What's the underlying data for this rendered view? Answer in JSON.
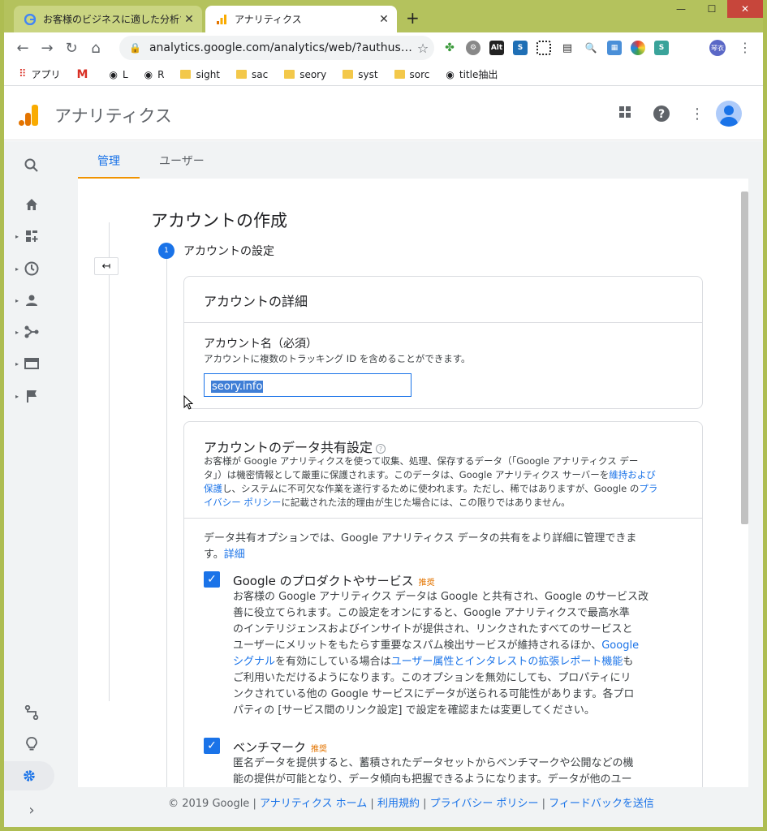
{
  "browser": {
    "tabs": [
      {
        "title": "お客様のビジネスに適した分析ツール",
        "active": false
      },
      {
        "title": "アナリティクス",
        "active": true
      }
    ],
    "new_tab_label": "+",
    "url": "analytics.google.com/analytics/web/?authus…",
    "bookmarks": [
      {
        "label": "アプリ",
        "icon": "apps-grid-icon"
      },
      {
        "label": "",
        "icon": "gmail-icon"
      },
      {
        "label": "L",
        "icon": "globe-icon"
      },
      {
        "label": "R",
        "icon": "globe-icon"
      },
      {
        "label": "sight",
        "icon": "folder-icon"
      },
      {
        "label": "sac",
        "icon": "folder-icon"
      },
      {
        "label": "seory",
        "icon": "folder-icon"
      },
      {
        "label": "syst",
        "icon": "folder-icon"
      },
      {
        "label": "sorc",
        "icon": "folder-icon"
      },
      {
        "label": "title抽出",
        "icon": "globe-icon"
      }
    ],
    "profile_initials": "琴衣",
    "extensions": [
      "Alt",
      "S",
      "S"
    ]
  },
  "app": {
    "title": "アナリティクス"
  },
  "subtabs": [
    {
      "label": "管理",
      "active": true
    },
    {
      "label": "ユーザー",
      "active": false
    }
  ],
  "content": {
    "page_title": "アカウントの作成",
    "step_number": "1",
    "step_label": "アカウントの設定",
    "details_card": {
      "heading": "アカウントの詳細",
      "name_label": "アカウント名（必須）",
      "name_help": "アカウントに複数のトラッキング ID を含めることができます。",
      "name_value": "seory.info"
    },
    "sharing_card": {
      "heading": "アカウントのデータ共有設定",
      "intro_a": "お客様が Google アナリティクスを使って収集、処理、保存するデータ（「Google アナリティクス デー",
      "intro_b": "タ」）は機密情報として厳重に保護されます。このデータは、Google アナリティクス サーバーを",
      "intro_link1": "維持およ",
      "intro_link1b": "び",
      "intro_c": "保護",
      "intro_d": "し、システムに不可欠な作業を遂行するために使われます。ただし、稀ではありますが、Google の",
      "intro_link2": "プラ",
      "intro_link2b": "イバシー ポリシー",
      "intro_e": "に記載された法的理由が生じた場合には、この限りではありません。",
      "options_intro": "データ共有オプションでは、Google アナリティクス データの共有をより詳細に管理できま",
      "options_intro2": "す。",
      "options_link": "詳細",
      "opt1_title": "Google のプロダクトやサービス",
      "opt1_badge": "推奨",
      "opt1_lines": [
        "お客様の Google アナリティクス データは Google と共有され、Google のサービス改",
        "善に役立てられます。この設定をオンにすると、Google アナリティクスで最高水準",
        "のインテリジェンスおよびインサイトが提供され、リンクされたすべてのサービスと",
        "ユーザーにメリットをもたらす重要なスパム検出サービスが維持されるほか、"
      ],
      "opt1_link1": "Google",
      "opt1_link1b": "シグナル",
      "opt1_mid": "を有効にしている場合は",
      "opt1_link2": "ユーザー属性とインタレストの拡張レポート機能",
      "opt1_mid2": "も",
      "opt1_lines2": [
        "ご利用いただけるようになります。このオプションを無効にしても、プロパティにリ",
        "ンクされている他の Google サービスにデータが送られる可能性があります。各プロ",
        "パティの [サービス間のリンク設定] で設定を確認または変更してください。"
      ],
      "opt2_title": "ベンチマーク",
      "opt2_badge": "推奨",
      "opt2_lines": [
        "匿名データを提供すると、蓄積されたデータセットからベンチマークや公開などの機",
        "能の提供が可能となり、データ傾向も把握できるようになります。データが他のユー"
      ]
    }
  },
  "footer": {
    "copyright": "© 2019 Google",
    "links": [
      "アナリティクス ホーム",
      "利用規約",
      "プライバシー ポリシー",
      "フィードバックを送信"
    ]
  },
  "colors": {
    "accent": "#1a73e8",
    "tab_underline": "#f09300",
    "titlebar": "#b4c25d"
  }
}
